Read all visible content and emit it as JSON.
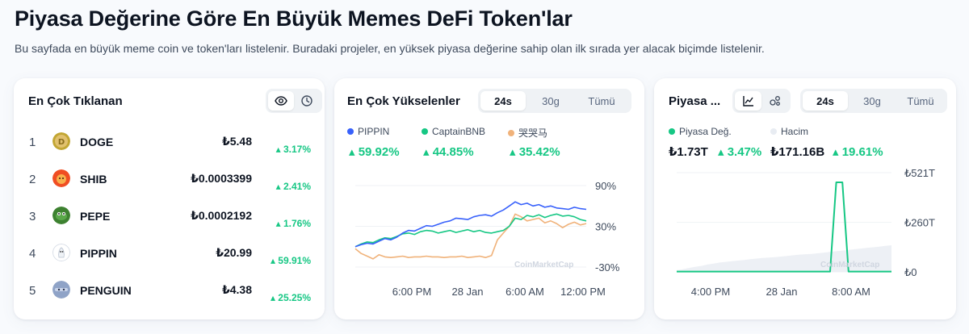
{
  "page": {
    "title": "Piyasa Değerine Göre En Büyük Memes DeFi Token'lar",
    "description": "Bu sayfada en büyük meme coin ve token'ları listelenir. Buradaki projeler, en yüksek piyasa değerine sahip olan ilk sırada yer alacak biçimde listelenir."
  },
  "colors": {
    "up": "#16c784",
    "pippin": "#3861fb",
    "captain": "#16c784",
    "third": "#f0b27a",
    "volume": "#e8ecf2"
  },
  "most_clicked": {
    "title": "En Çok Tıklanan",
    "icons": [
      "eye-icon",
      "clock-icon"
    ],
    "items": [
      {
        "rank": "1",
        "symbol": "DOGE",
        "price": "₺5.48",
        "change": "3.17%",
        "icon": "doge-logo"
      },
      {
        "rank": "2",
        "symbol": "SHIB",
        "price": "₺0.0003399",
        "change": "2.41%",
        "icon": "shib-logo"
      },
      {
        "rank": "3",
        "symbol": "PEPE",
        "price": "₺0.0002192",
        "change": "1.76%",
        "icon": "pepe-logo"
      },
      {
        "rank": "4",
        "symbol": "PIPPIN",
        "price": "₺20.99",
        "change": "59.91%",
        "icon": "pippin-logo"
      },
      {
        "rank": "5",
        "symbol": "PENGUIN",
        "price": "₺4.38",
        "change": "25.25%",
        "icon": "penguin-logo"
      }
    ]
  },
  "top_gainers": {
    "title": "En Çok Yükselenler",
    "tabs": [
      "24s",
      "30g",
      "Tümü"
    ],
    "active_tab": "24s",
    "watermark": "CoinMarketCap",
    "legend": [
      {
        "name": "PIPPIN",
        "value": "59.92%"
      },
      {
        "name": "CaptainBNB",
        "value": "44.85%"
      },
      {
        "name": "哭哭马",
        "value": "35.42%"
      }
    ]
  },
  "market_cap": {
    "title": "Piyasa ...",
    "icons": [
      "line-chart-icon",
      "bubbles-icon"
    ],
    "tabs": [
      "24s",
      "30g",
      "Tümü"
    ],
    "active_tab": "24s",
    "watermark": "CoinMarketCap",
    "legend": {
      "cap_label": "Piyasa Değ.",
      "volume_label": "Hacim"
    },
    "cap_value": "₺1.73T",
    "cap_change": "3.47%",
    "volume_value": "₺171.16B",
    "volume_change": "19.61%"
  },
  "chart_data": [
    {
      "type": "line",
      "title": "En Çok Yükselenler",
      "x_ticks": [
        "6:00 PM",
        "28 Jan",
        "6:00 AM",
        "12:00 PM"
      ],
      "y_ticks": [
        "90%",
        "30%",
        "-30%"
      ],
      "ylim": [
        -30,
        90
      ],
      "grid": true,
      "series": [
        {
          "name": "PIPPIN",
          "values": [
            0,
            3,
            5,
            4,
            8,
            12,
            10,
            14,
            20,
            24,
            23,
            27,
            31,
            30,
            33,
            36,
            38,
            42,
            41,
            40,
            44,
            46,
            47,
            45,
            50,
            54,
            60,
            66,
            62,
            64,
            60,
            62,
            58,
            60,
            57,
            56,
            55,
            58,
            56,
            55
          ]
        },
        {
          "name": "CaptainBNB",
          "values": [
            0,
            4,
            7,
            6,
            10,
            13,
            12,
            15,
            19,
            20,
            18,
            22,
            24,
            23,
            20,
            22,
            24,
            21,
            23,
            25,
            22,
            24,
            21,
            20,
            22,
            24,
            30,
            42,
            40,
            46,
            44,
            47,
            43,
            46,
            48,
            45,
            46,
            44,
            40,
            38
          ]
        },
        {
          "name": "哭哭马",
          "values": [
            -3,
            -10,
            -14,
            -18,
            -12,
            -15,
            -16,
            -15,
            -14,
            -16,
            -15,
            -15,
            -14,
            -15,
            -15,
            -16,
            -15,
            -15,
            -14,
            -16,
            -15,
            -14,
            -16,
            -13,
            10,
            20,
            30,
            48,
            44,
            38,
            40,
            42,
            35,
            38,
            34,
            28,
            33,
            36,
            32,
            34
          ]
        }
      ]
    },
    {
      "type": "line",
      "title": "Piyasa Değ.",
      "x_ticks": [
        "4:00 PM",
        "28 Jan",
        "8:00 AM"
      ],
      "y_ticks": [
        "₺521T",
        "₺260T",
        "₺0"
      ],
      "ylim": [
        0,
        521
      ],
      "grid": true,
      "series": [
        {
          "name": "Piyasa Değ.",
          "values": [
            1.7,
            1.7,
            1.7,
            1.7,
            1.7,
            1.7,
            1.7,
            1.7,
            1.7,
            1.7,
            1.7,
            1.7,
            1.7,
            1.7,
            1.7,
            1.7,
            1.7,
            1.7,
            1.7,
            1.7,
            1.7,
            1.7,
            1.7,
            1.7,
            1.7,
            1.7,
            470,
            470,
            1.7,
            1.7,
            1.7,
            1.7,
            1.7,
            1.7,
            1.7,
            1.7
          ]
        },
        {
          "name": "Hacim",
          "values": [
            5,
            8,
            12,
            15,
            18,
            22,
            25,
            28,
            30,
            32,
            34,
            36,
            38,
            40,
            42,
            43,
            44,
            46,
            48,
            50,
            52,
            53,
            54,
            56,
            58,
            60,
            62,
            64,
            66,
            68,
            70,
            72,
            74,
            76,
            78,
            80
          ]
        }
      ]
    }
  ]
}
